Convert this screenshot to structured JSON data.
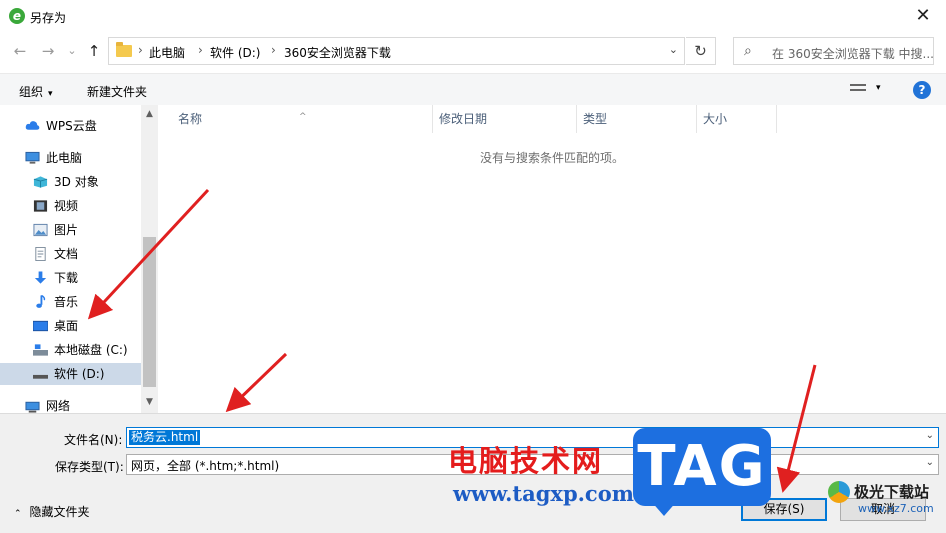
{
  "window": {
    "icon_glyph": "e",
    "title": "另存为",
    "close_glyph": "✕"
  },
  "nav": {
    "back_glyph": "←",
    "forward_glyph": "→",
    "recent_glyph": "⌄",
    "up_glyph": "↑",
    "breadcrumb": [
      "此电脑",
      "软件 (D:)",
      "360安全浏览器下载"
    ],
    "breadcrumb_sep": "›",
    "dropdown_glyph": "⌄",
    "refresh_glyph": "↻",
    "search_placeholder": "在 360安全浏览器下载 中搜..."
  },
  "toolbar": {
    "organize_label": "组织",
    "new_folder_label": "新建文件夹",
    "caret_glyph": "▾",
    "help_glyph": "?"
  },
  "sidebar": {
    "items": [
      {
        "label": "WPS云盘",
        "icon": "cloud-icon"
      },
      {
        "label": "此电脑",
        "icon": "computer-icon"
      },
      {
        "label": "3D 对象",
        "icon": "3d-objects-icon"
      },
      {
        "label": "视频",
        "icon": "video-icon"
      },
      {
        "label": "图片",
        "icon": "pictures-icon"
      },
      {
        "label": "文档",
        "icon": "document-icon"
      },
      {
        "label": "下载",
        "icon": "download-icon"
      },
      {
        "label": "音乐",
        "icon": "music-icon"
      },
      {
        "label": "桌面",
        "icon": "desktop-icon"
      },
      {
        "label": "本地磁盘 (C:)",
        "icon": "drive-icon"
      },
      {
        "label": "软件 (D:)",
        "icon": "drive-icon"
      },
      {
        "label": "网络",
        "icon": "network-icon"
      }
    ],
    "selected_index": 10,
    "scroll_up_glyph": "▲",
    "scroll_down_glyph": "▼"
  },
  "file_list": {
    "columns": [
      "名称",
      "修改日期",
      "类型",
      "大小"
    ],
    "sort_glyph": "^",
    "empty_message": "没有与搜索条件匹配的项。"
  },
  "form": {
    "filename_label": "文件名(N):",
    "filename_value": "税务云.html",
    "filetype_label": "保存类型(T):",
    "filetype_value": "网页，全部 (*.htm;*.html)",
    "dropdown_glyph": "⌄"
  },
  "footer": {
    "hide_folders_label": "隐藏文件夹",
    "hide_caret_glyph": "⌃",
    "save_label": "保存(S)",
    "cancel_label": "取消"
  },
  "watermarks": {
    "cn_text": "电脑技术网",
    "url_text": "www.tagxp.com",
    "tag_text": "TAG",
    "site2_cn": "极光下载站",
    "site2_url": "www.xz7.com"
  },
  "colors": {
    "accent": "#0078d7",
    "selection_bg": "#ccd9e8",
    "annotation_arrow": "#e02020",
    "watermark_red": "#e41c1c",
    "watermark_blue": "#1d6fe0"
  }
}
